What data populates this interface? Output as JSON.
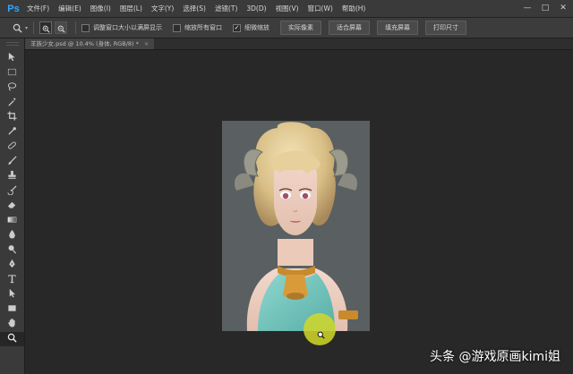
{
  "app": {
    "logo": "Ps"
  },
  "menubar": {
    "items": [
      "文件(F)",
      "编辑(E)",
      "图像(I)",
      "图层(L)",
      "文字(Y)",
      "选择(S)",
      "滤镜(T)",
      "3D(D)",
      "视图(V)",
      "窗口(W)",
      "帮助(H)"
    ],
    "window_controls": [
      "—",
      "□",
      "✕"
    ]
  },
  "options_bar": {
    "tool_icon": "zoom-icon",
    "zoom_in_icon": "zoom-in-icon",
    "zoom_out_icon": "zoom-out-icon",
    "checkbox_resize_windows": {
      "label": "调整窗口大小以满屏显示",
      "checked": false
    },
    "checkbox_zoom_all": {
      "label": "缩放所有窗口",
      "checked": false
    },
    "checkbox_scrubby_zoom": {
      "label": "细微缩放",
      "checked": true
    },
    "buttons": [
      "实际像素",
      "适合屏幕",
      "填充屏幕",
      "打印尺寸"
    ]
  },
  "document_tab": {
    "title": "羊族少女.psd @ 10.4% (身体, RGB/8) *",
    "close": "×"
  },
  "tools": [
    "move-icon",
    "marquee-icon",
    "lasso-icon",
    "magic-wand-icon",
    "crop-icon",
    "eyedropper-icon",
    "healing-brush-icon",
    "brush-icon",
    "clone-stamp-icon",
    "history-brush-icon",
    "eraser-icon",
    "gradient-icon",
    "blur-icon",
    "dodge-icon",
    "pen-icon",
    "type-icon",
    "path-selection-icon",
    "rectangle-icon",
    "hand-icon",
    "zoom-icon"
  ],
  "watermark": "头条 @游戏原画kimi姐",
  "colors": {
    "accent": "#31a8ff",
    "canvas_bg": "#282828",
    "artwork_bg": "#5a5f61",
    "cursor_highlight": "#d2d728"
  }
}
